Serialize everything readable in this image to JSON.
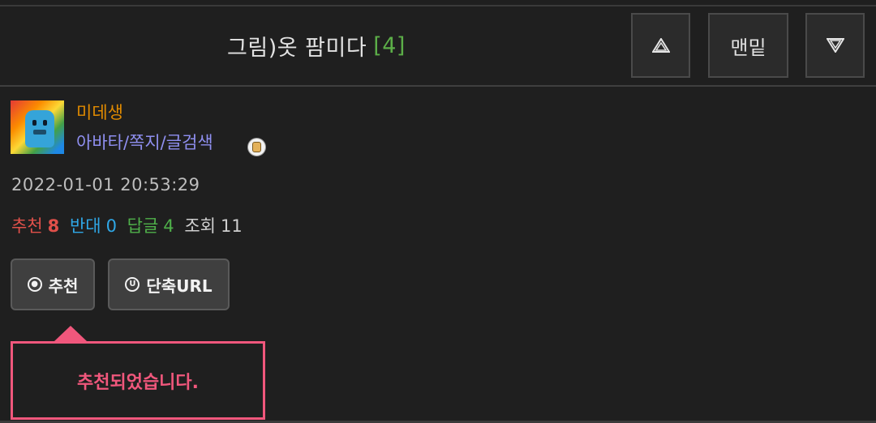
{
  "header": {
    "title": "그림)옷 팜미다",
    "comment_count": "[4]",
    "btn_bottom_label": "맨밑"
  },
  "author": {
    "name": "미데생",
    "links": "아바타/쪽지/글검색",
    "avatar_icon": "pixel-character-avatar",
    "badge_icon": "level-badge-icon"
  },
  "post": {
    "datetime": "2022-01-01 20:53:29"
  },
  "stats": {
    "recommend_label": "추천",
    "recommend_value": "8",
    "oppose_label": "반대",
    "oppose_value": "0",
    "reply_label": "답글",
    "reply_value": "4",
    "view_label": "조회",
    "view_value": "11"
  },
  "actions": {
    "recommend_label": "추천",
    "short_url_label": "단축URL"
  },
  "tooltip": {
    "message": "추천되었습니다."
  },
  "colors": {
    "background": "#1f1f1f",
    "username": "#e08a00",
    "userlinks": "#8f8ff0",
    "recommend": "#e0504a",
    "oppose": "#2fa7e6",
    "reply": "#4fb04a",
    "tooltip": "#f0577c"
  }
}
